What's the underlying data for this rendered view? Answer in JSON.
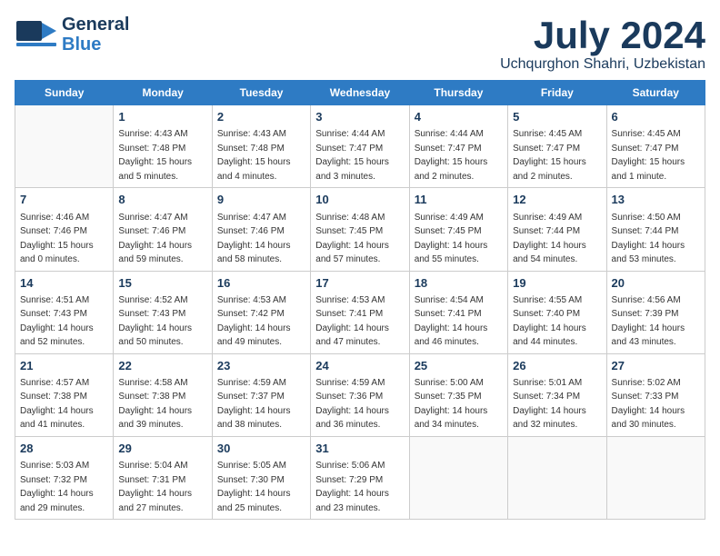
{
  "header": {
    "logo_general": "General",
    "logo_blue": "Blue",
    "month_title": "July 2024",
    "location": "Uchqurghon Shahri, Uzbekistan"
  },
  "days_of_week": [
    "Sunday",
    "Monday",
    "Tuesday",
    "Wednesday",
    "Thursday",
    "Friday",
    "Saturday"
  ],
  "weeks": [
    [
      {
        "day": "",
        "sunrise": "",
        "sunset": "",
        "daylight": ""
      },
      {
        "day": "1",
        "sunrise": "Sunrise: 4:43 AM",
        "sunset": "Sunset: 7:48 PM",
        "daylight": "Daylight: 15 hours and 5 minutes."
      },
      {
        "day": "2",
        "sunrise": "Sunrise: 4:43 AM",
        "sunset": "Sunset: 7:48 PM",
        "daylight": "Daylight: 15 hours and 4 minutes."
      },
      {
        "day": "3",
        "sunrise": "Sunrise: 4:44 AM",
        "sunset": "Sunset: 7:47 PM",
        "daylight": "Daylight: 15 hours and 3 minutes."
      },
      {
        "day": "4",
        "sunrise": "Sunrise: 4:44 AM",
        "sunset": "Sunset: 7:47 PM",
        "daylight": "Daylight: 15 hours and 2 minutes."
      },
      {
        "day": "5",
        "sunrise": "Sunrise: 4:45 AM",
        "sunset": "Sunset: 7:47 PM",
        "daylight": "Daylight: 15 hours and 2 minutes."
      },
      {
        "day": "6",
        "sunrise": "Sunrise: 4:45 AM",
        "sunset": "Sunset: 7:47 PM",
        "daylight": "Daylight: 15 hours and 1 minute."
      }
    ],
    [
      {
        "day": "7",
        "sunrise": "Sunrise: 4:46 AM",
        "sunset": "Sunset: 7:46 PM",
        "daylight": "Daylight: 15 hours and 0 minutes."
      },
      {
        "day": "8",
        "sunrise": "Sunrise: 4:47 AM",
        "sunset": "Sunset: 7:46 PM",
        "daylight": "Daylight: 14 hours and 59 minutes."
      },
      {
        "day": "9",
        "sunrise": "Sunrise: 4:47 AM",
        "sunset": "Sunset: 7:46 PM",
        "daylight": "Daylight: 14 hours and 58 minutes."
      },
      {
        "day": "10",
        "sunrise": "Sunrise: 4:48 AM",
        "sunset": "Sunset: 7:45 PM",
        "daylight": "Daylight: 14 hours and 57 minutes."
      },
      {
        "day": "11",
        "sunrise": "Sunrise: 4:49 AM",
        "sunset": "Sunset: 7:45 PM",
        "daylight": "Daylight: 14 hours and 55 minutes."
      },
      {
        "day": "12",
        "sunrise": "Sunrise: 4:49 AM",
        "sunset": "Sunset: 7:44 PM",
        "daylight": "Daylight: 14 hours and 54 minutes."
      },
      {
        "day": "13",
        "sunrise": "Sunrise: 4:50 AM",
        "sunset": "Sunset: 7:44 PM",
        "daylight": "Daylight: 14 hours and 53 minutes."
      }
    ],
    [
      {
        "day": "14",
        "sunrise": "Sunrise: 4:51 AM",
        "sunset": "Sunset: 7:43 PM",
        "daylight": "Daylight: 14 hours and 52 minutes."
      },
      {
        "day": "15",
        "sunrise": "Sunrise: 4:52 AM",
        "sunset": "Sunset: 7:43 PM",
        "daylight": "Daylight: 14 hours and 50 minutes."
      },
      {
        "day": "16",
        "sunrise": "Sunrise: 4:53 AM",
        "sunset": "Sunset: 7:42 PM",
        "daylight": "Daylight: 14 hours and 49 minutes."
      },
      {
        "day": "17",
        "sunrise": "Sunrise: 4:53 AM",
        "sunset": "Sunset: 7:41 PM",
        "daylight": "Daylight: 14 hours and 47 minutes."
      },
      {
        "day": "18",
        "sunrise": "Sunrise: 4:54 AM",
        "sunset": "Sunset: 7:41 PM",
        "daylight": "Daylight: 14 hours and 46 minutes."
      },
      {
        "day": "19",
        "sunrise": "Sunrise: 4:55 AM",
        "sunset": "Sunset: 7:40 PM",
        "daylight": "Daylight: 14 hours and 44 minutes."
      },
      {
        "day": "20",
        "sunrise": "Sunrise: 4:56 AM",
        "sunset": "Sunset: 7:39 PM",
        "daylight": "Daylight: 14 hours and 43 minutes."
      }
    ],
    [
      {
        "day": "21",
        "sunrise": "Sunrise: 4:57 AM",
        "sunset": "Sunset: 7:38 PM",
        "daylight": "Daylight: 14 hours and 41 minutes."
      },
      {
        "day": "22",
        "sunrise": "Sunrise: 4:58 AM",
        "sunset": "Sunset: 7:38 PM",
        "daylight": "Daylight: 14 hours and 39 minutes."
      },
      {
        "day": "23",
        "sunrise": "Sunrise: 4:59 AM",
        "sunset": "Sunset: 7:37 PM",
        "daylight": "Daylight: 14 hours and 38 minutes."
      },
      {
        "day": "24",
        "sunrise": "Sunrise: 4:59 AM",
        "sunset": "Sunset: 7:36 PM",
        "daylight": "Daylight: 14 hours and 36 minutes."
      },
      {
        "day": "25",
        "sunrise": "Sunrise: 5:00 AM",
        "sunset": "Sunset: 7:35 PM",
        "daylight": "Daylight: 14 hours and 34 minutes."
      },
      {
        "day": "26",
        "sunrise": "Sunrise: 5:01 AM",
        "sunset": "Sunset: 7:34 PM",
        "daylight": "Daylight: 14 hours and 32 minutes."
      },
      {
        "day": "27",
        "sunrise": "Sunrise: 5:02 AM",
        "sunset": "Sunset: 7:33 PM",
        "daylight": "Daylight: 14 hours and 30 minutes."
      }
    ],
    [
      {
        "day": "28",
        "sunrise": "Sunrise: 5:03 AM",
        "sunset": "Sunset: 7:32 PM",
        "daylight": "Daylight: 14 hours and 29 minutes."
      },
      {
        "day": "29",
        "sunrise": "Sunrise: 5:04 AM",
        "sunset": "Sunset: 7:31 PM",
        "daylight": "Daylight: 14 hours and 27 minutes."
      },
      {
        "day": "30",
        "sunrise": "Sunrise: 5:05 AM",
        "sunset": "Sunset: 7:30 PM",
        "daylight": "Daylight: 14 hours and 25 minutes."
      },
      {
        "day": "31",
        "sunrise": "Sunrise: 5:06 AM",
        "sunset": "Sunset: 7:29 PM",
        "daylight": "Daylight: 14 hours and 23 minutes."
      },
      {
        "day": "",
        "sunrise": "",
        "sunset": "",
        "daylight": ""
      },
      {
        "day": "",
        "sunrise": "",
        "sunset": "",
        "daylight": ""
      },
      {
        "day": "",
        "sunrise": "",
        "sunset": "",
        "daylight": ""
      }
    ]
  ]
}
